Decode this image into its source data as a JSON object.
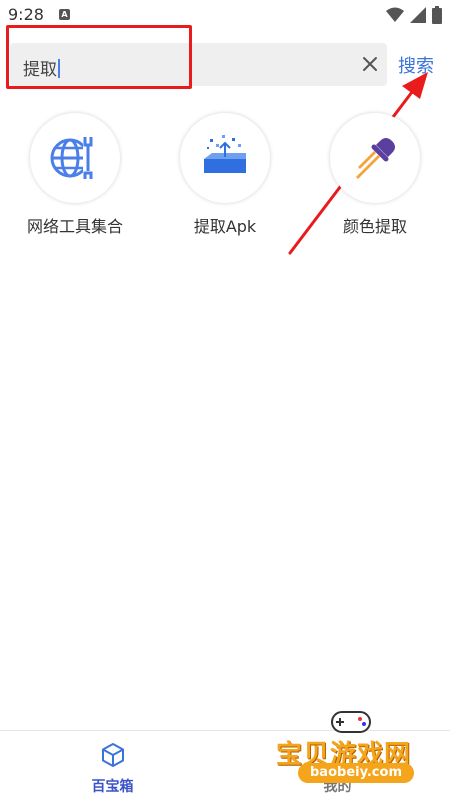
{
  "status_bar": {
    "time": "9:28",
    "badge": "A"
  },
  "search": {
    "value": "提取",
    "button_label": "搜索"
  },
  "tools": [
    {
      "label": "网络工具集合",
      "icon": "globe-wrench-icon"
    },
    {
      "label": "提取Apk",
      "icon": "upload-box-icon"
    },
    {
      "label": "颜色提取",
      "icon": "eyedropper-icon"
    }
  ],
  "bottom_nav": [
    {
      "label": "百宝箱",
      "icon": "cube-icon",
      "active": true
    },
    {
      "label": "我的",
      "icon": "person-icon",
      "active": false
    }
  ],
  "watermark": {
    "text": "宝贝游戏网",
    "url": "baobeiy.com"
  },
  "colors": {
    "accent": "#3b73d9",
    "icon_blue": "#4a7ee8",
    "active_nav": "#3b53c9",
    "annotation_red": "#e81c1c",
    "eyedropper_purple": "#5b3f9e"
  }
}
